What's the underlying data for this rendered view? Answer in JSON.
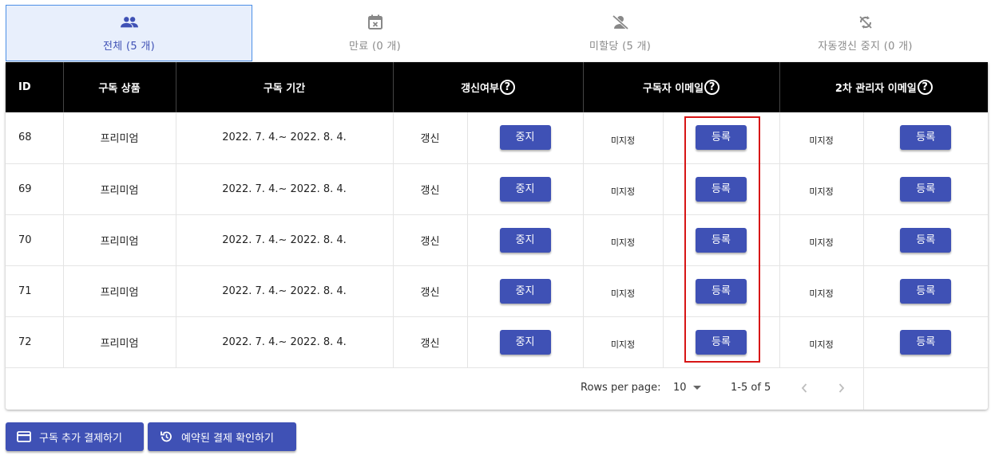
{
  "tabs": [
    {
      "label": "전체 (5 개)",
      "icon": "group-icon",
      "active": true
    },
    {
      "label": "만료 (0 개)",
      "icon": "event-busy-icon",
      "active": false
    },
    {
      "label": "미할당 (5 개)",
      "icon": "person-off-icon",
      "active": false
    },
    {
      "label": "자동갱신 중지 (0 개)",
      "icon": "sync-disabled-icon",
      "active": false
    }
  ],
  "table": {
    "headers": {
      "id": "ID",
      "product": "구독 상품",
      "period": "구독 기간",
      "renewal": "갱신여부",
      "subscriber_email": "구독자 이메일",
      "admin_email": "2차 관리자 이메일",
      "help": "?"
    },
    "rows": [
      {
        "id": "68",
        "product": "프리미엄",
        "period": "2022. 7. 4.~ 2022. 8. 4.",
        "renewal": "갱신",
        "renewal_btn": "중지",
        "subscriber_email": "미지정",
        "subscriber_btn": "등록",
        "admin_email": "미지정",
        "admin_btn": "등록"
      },
      {
        "id": "69",
        "product": "프리미엄",
        "period": "2022. 7. 4.~ 2022. 8. 4.",
        "renewal": "갱신",
        "renewal_btn": "중지",
        "subscriber_email": "미지정",
        "subscriber_btn": "등록",
        "admin_email": "미지정",
        "admin_btn": "등록"
      },
      {
        "id": "70",
        "product": "프리미엄",
        "period": "2022. 7. 4.~ 2022. 8. 4.",
        "renewal": "갱신",
        "renewal_btn": "중지",
        "subscriber_email": "미지정",
        "subscriber_btn": "등록",
        "admin_email": "미지정",
        "admin_btn": "등록"
      },
      {
        "id": "71",
        "product": "프리미엄",
        "period": "2022. 7. 4.~ 2022. 8. 4.",
        "renewal": "갱신",
        "renewal_btn": "중지",
        "subscriber_email": "미지정",
        "subscriber_btn": "등록",
        "admin_email": "미지정",
        "admin_btn": "등록"
      },
      {
        "id": "72",
        "product": "프리미엄",
        "period": "2022. 7. 4.~ 2022. 8. 4.",
        "renewal": "갱신",
        "renewal_btn": "중지",
        "subscriber_email": "미지정",
        "subscriber_btn": "등록",
        "admin_email": "미지정",
        "admin_btn": "등록"
      }
    ]
  },
  "pagination": {
    "rows_per_page_label": "Rows per page:",
    "rows_per_page_value": "10",
    "range": "1-5 of 5"
  },
  "actions": {
    "add_payment": "구독 추가 결제하기",
    "check_scheduled": "예약된 결제 확인하기"
  },
  "colors": {
    "primary": "#3f51b5",
    "header_bg": "#000000",
    "active_tab_bg": "#e8effc",
    "highlight": "#d71515"
  }
}
